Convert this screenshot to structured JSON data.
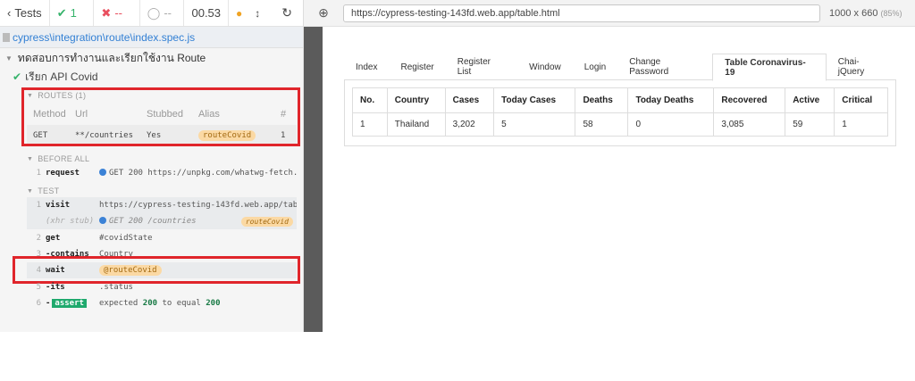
{
  "reporter": {
    "header": {
      "tests_label": "Tests",
      "passed": "1",
      "failed": "--",
      "pending": "--",
      "duration": "00.53"
    },
    "spec_path": "cypress\\integration\\route\\index.spec.js",
    "suite_title": "ทดสอบการทำงานและเรียกใช้งาน Route",
    "test_title": "เรียก API Covid",
    "routes": {
      "heading": "ROUTES (1)",
      "columns": [
        "Method",
        "Url",
        "Stubbed",
        "Alias",
        "#"
      ],
      "row": {
        "method": "GET",
        "url": "**/countries",
        "stubbed": "Yes",
        "alias": "routeCovid",
        "count": "1"
      }
    },
    "before_all": {
      "heading": "BEFORE ALL",
      "num": "1",
      "name": "request",
      "message": "GET 200 https://unpkg.com/whatwg-fetch..."
    },
    "test_section": {
      "heading": "TEST",
      "commands": [
        {
          "num": "1",
          "name": "visit",
          "message": "https://cypress-testing-143fd.web.app/tab..."
        },
        {
          "num": "",
          "name": "(xhr stub)",
          "message": "GET 200 /countries",
          "alias": "routeCovid"
        },
        {
          "num": "2",
          "name": "get",
          "message": "#covidState"
        },
        {
          "num": "3",
          "name": "-contains",
          "message": "Country"
        },
        {
          "num": "4",
          "name": "wait",
          "alias": "@routeCovid"
        },
        {
          "num": "5",
          "name": "-its",
          "message": ".status"
        },
        {
          "num": "6",
          "name": "-",
          "badge": "assert",
          "msg_a": "expected",
          "msg_b": "200",
          "msg_c": "to equal",
          "msg_d": "200"
        }
      ]
    }
  },
  "aut": {
    "url": "https://cypress-testing-143fd.web.app/table.html",
    "viewport": "1000 x 660",
    "scale": "(85%)",
    "tabs": [
      "Index",
      "Register",
      "Register List",
      "Window",
      "Login",
      "Change Password",
      "Table Coronavirus-19",
      "Chai-jQuery"
    ],
    "active_tab": "Table Coronavirus-19",
    "table": {
      "headers": [
        "No.",
        "Country",
        "Cases",
        "Today Cases",
        "Deaths",
        "Today Deaths",
        "Recovered",
        "Active",
        "Critical"
      ],
      "rows": [
        [
          "1",
          "Thailand",
          "3,202",
          "5",
          "58",
          "0",
          "3,085",
          "59",
          "1"
        ]
      ]
    }
  },
  "colors": {
    "pass": "#36b36b",
    "fail": "#e94f5f",
    "link": "#3380d4",
    "alias_bg": "#fbd9a4",
    "highlight_border": "#e0252b",
    "assert_bg": "#1fa96d"
  },
  "icons": [
    "chevron-left-icon",
    "check-icon",
    "x-icon",
    "pending-circle-icon",
    "status-dot-icon",
    "scroll-arrows-icon",
    "reload-icon",
    "crosshair-icon",
    "file-icon"
  ]
}
